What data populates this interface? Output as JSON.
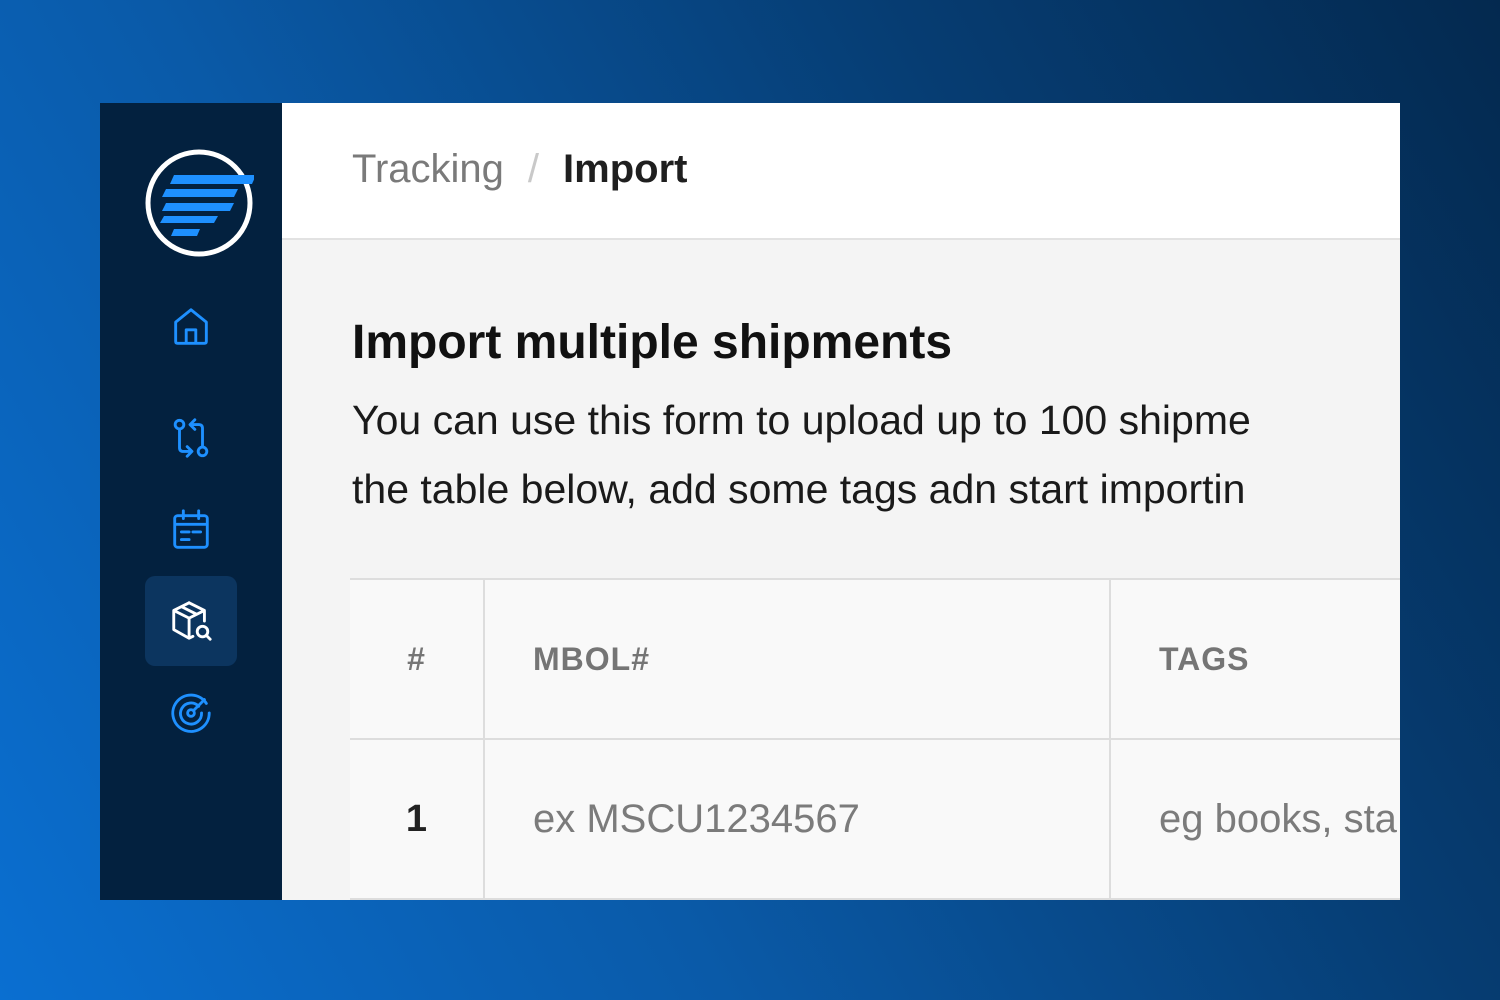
{
  "sidebar": {
    "logo": "app-logo",
    "items": [
      {
        "icon": "home-icon",
        "active": false
      },
      {
        "icon": "git-compare-icon",
        "active": false
      },
      {
        "icon": "calendar-icon",
        "active": false
      },
      {
        "icon": "package-search-icon",
        "active": true
      },
      {
        "icon": "radar-icon",
        "active": false
      }
    ],
    "accent_color": "#1e90ff",
    "background_color": "#03213f"
  },
  "header": {
    "breadcrumb": {
      "parent": "Tracking",
      "separator": "/",
      "current": "Import"
    }
  },
  "main": {
    "title": "Import multiple shipments",
    "description_line1": "You can use this form to upload up to 100 shipme",
    "description_line2": "the table below, add some tags adn start importin"
  },
  "table": {
    "columns": [
      "#",
      "MBOL#",
      "TAGS"
    ],
    "rows": [
      {
        "index": "1",
        "mbol_placeholder": "ex MSCU1234567",
        "tags_placeholder": "eg books, sta"
      }
    ]
  }
}
